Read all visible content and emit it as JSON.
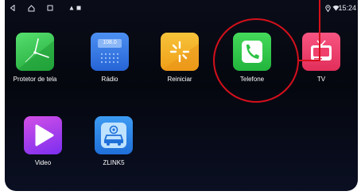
{
  "status_bar": {
    "time": "15:24",
    "icons": [
      "back-icon",
      "home-icon",
      "recents-icon",
      "notification-icon",
      "location-icon",
      "wifi-icon"
    ]
  },
  "apps": [
    {
      "label": "Protetor de tela",
      "icon": "clock-icon",
      "color": "#3fcf5a"
    },
    {
      "label": "Rádio",
      "icon": "radio-icon",
      "color": "#3b7be6",
      "screen_text": "108.0"
    },
    {
      "label": "Reiniciar",
      "icon": "restart-icon",
      "color": "#f3b022"
    },
    {
      "label": "Telefone",
      "icon": "phone-icon",
      "color": "#34c24a"
    },
    {
      "label": "TV",
      "icon": "tv-icon",
      "color": "#f0406c"
    },
    {
      "label": "Video",
      "icon": "play-icon",
      "color": "#9b37e8"
    },
    {
      "label": "ZLINK5",
      "icon": "car-link-icon",
      "color": "#2f8be8"
    }
  ],
  "colors": {
    "annotation": "#d4101c"
  }
}
